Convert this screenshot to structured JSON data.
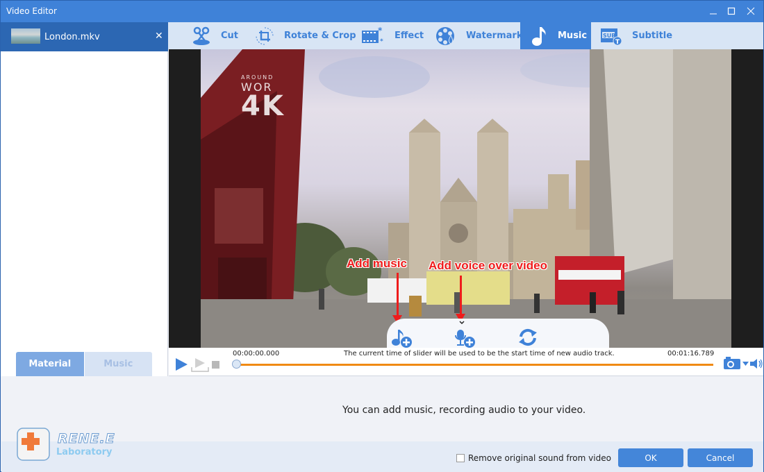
{
  "window": {
    "title": "Video Editor",
    "controls": {
      "minimize": "—",
      "maximize": "☐",
      "close": "✕"
    }
  },
  "sidebar": {
    "file": {
      "name": "London.mkv",
      "close": "✕"
    },
    "tabs": [
      {
        "label": "Material",
        "active": true
      },
      {
        "label": "Music",
        "active": false
      }
    ]
  },
  "toolbar": {
    "tabs": [
      {
        "label": "Cut",
        "icon": "scissors-icon"
      },
      {
        "label": "Rotate & Crop",
        "icon": "crop-rotate-icon"
      },
      {
        "label": "Effect",
        "icon": "effect-film-icon"
      },
      {
        "label": "Watermark",
        "icon": "watermark-reel-icon"
      },
      {
        "label": "Music",
        "icon": "music-note-icon",
        "active": true
      },
      {
        "label": "Subtitle",
        "icon": "subtitle-icon"
      }
    ]
  },
  "preview": {
    "watermark": {
      "top": "AROUND",
      "mid": "WOR",
      "big": "4K"
    },
    "annotations": {
      "add_music": "Add music",
      "add_voice": "Add voice over video"
    },
    "actions": [
      {
        "name": "add-music",
        "icon": "music-add-icon"
      },
      {
        "name": "add-voice",
        "icon": "microphone-add-icon"
      },
      {
        "name": "reset",
        "icon": "refresh-icon"
      }
    ]
  },
  "player": {
    "time_start": "00:00:00.000",
    "time_end": "00:01:16.789",
    "hint": "The current time of slider will be used to be the start time of new audio track.",
    "position_fraction": 0.0
  },
  "info": {
    "message": "You can add music, recording audio to your video."
  },
  "footer": {
    "brand": "RENE.E",
    "brand_sub": "Laboratory",
    "remove_sound_label": "Remove original sound from video",
    "remove_sound_checked": false,
    "ok": "OK",
    "cancel": "Cancel"
  },
  "colors": {
    "accent": "#3f82d8",
    "progress": "#f08a14",
    "annotation": "#ee1c1c"
  }
}
